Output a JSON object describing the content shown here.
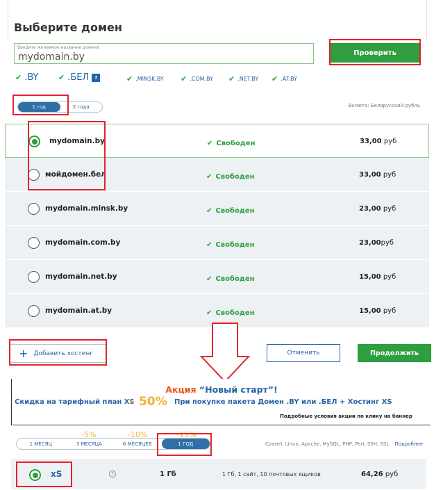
{
  "header": {
    "title": "Выберите домен",
    "input_placeholder": "Введите желаемое название домена",
    "input_value": "mydomain.by",
    "check_label": "Проверить"
  },
  "zones": [
    {
      "label": ".BY"
    },
    {
      "label": ".БЕЛ",
      "badge": "?"
    },
    {
      "label": ".MINSK.BY"
    },
    {
      "label": ".COM.BY"
    },
    {
      "label": ".NET.BY"
    },
    {
      "label": ".AT.BY"
    }
  ],
  "period": {
    "options": [
      "1 год",
      "2 года"
    ],
    "selected": "1 год",
    "currency": "Валюта: Белорусский рубль"
  },
  "domains": [
    {
      "name": "mydomain.by",
      "status": "Свободен",
      "price_value": "33,00",
      "price_unit": "руб",
      "selected": true
    },
    {
      "name": "мойдомен.бел",
      "status": "Свободен",
      "price_value": "33,00",
      "price_unit": "руб",
      "selected": false
    },
    {
      "name": "mydomain.minsk.by",
      "status": "Свободен",
      "price_value": "23,00",
      "price_unit": "руб",
      "selected": false
    },
    {
      "name": "mydomain.com.by",
      "status": "Свободен",
      "price_value": "23,00",
      "price_unit": "руб",
      "selected": false
    },
    {
      "name": "mydomain.net.by",
      "status": "Свободен",
      "price_value": "15,00",
      "price_unit": "руб",
      "selected": false
    },
    {
      "name": "mydomain.at.by",
      "status": "Свободен",
      "price_value": "15,00",
      "price_unit": "руб",
      "selected": false
    }
  ],
  "actions": {
    "add_hosting": "Добавить хостинг",
    "cancel": "Отменить",
    "continue": "Продолжить"
  },
  "banner": {
    "head_a": "Акция",
    "head_b": "“Новый старт”!",
    "left": "Скидка на тарифный план XS",
    "discount": "- 50%",
    "right": "При покупке пакета Домен .BY или .БЕЛ + Хостинг XS",
    "terms": "Подробные условия акции по клику на баннер"
  },
  "hosting": {
    "discounts": [
      "-5%",
      "-10%",
      "-15%"
    ],
    "terms": [
      "1 МЕСЯЦ",
      "3 МЕСЯЦА",
      "6 МЕСЯЦЕВ",
      "1 ГОД"
    ],
    "selected_term": "1 ГОД",
    "tech": "Cpanel, Linux, Apache, MySQL, PHP, Perl, SSH, SSL",
    "more": "Подробнее",
    "plan": {
      "name": "xS",
      "help": "?",
      "disk": "1 Гб",
      "desc": "1 Гб, 1 сайт, 10 почтовых ящиков",
      "price_value": "64,26",
      "price_unit": "руб"
    }
  },
  "colors": {
    "accent_green": "#2e9e3e",
    "link_blue": "#2563a8",
    "annotation_red": "#e3242b",
    "promo_orange": "#e8551a",
    "promo_yellow": "#f2b234"
  }
}
